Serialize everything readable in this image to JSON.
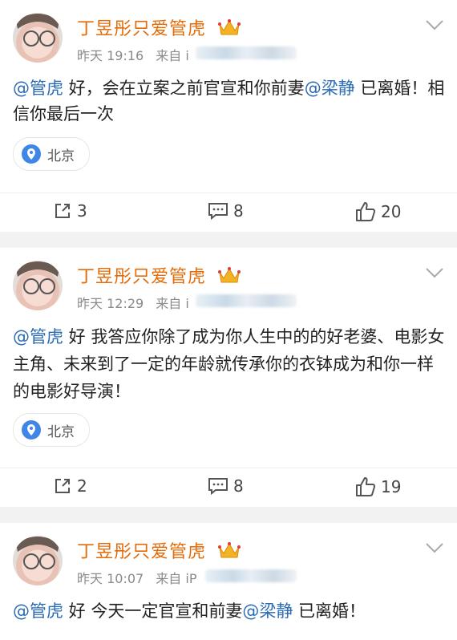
{
  "posts": [
    {
      "author": "丁昱彤只爱管虎",
      "time": "昨天 19:16",
      "source_prefix": "来自 i",
      "text_parts": [
        "@管虎",
        " 好，会在立案之前官宣和你前妻",
        "@梁静",
        " 已离婚！相信你最后一次"
      ],
      "location": "北京",
      "reposts": "3",
      "comments": "8",
      "likes": "20"
    },
    {
      "author": "丁昱彤只爱管虎",
      "time": "昨天 12:29",
      "source_prefix": "来自 i",
      "text_parts": [
        "@管虎",
        " 好 我答应你除了成为你人生中的的好老婆、电影女主角、未来到了一定的年龄就传承你的衣钵成为和你一样的电影好导演！"
      ],
      "location": "北京",
      "reposts": "2",
      "comments": "8",
      "likes": "19"
    },
    {
      "author": "丁昱彤只爱管虎",
      "time": "昨天 10:07",
      "source_prefix": "来自 iP",
      "text_parts": [
        "@管虎",
        " 好 今天一定官宣和前妻",
        "@梁静",
        " 已离婚！"
      ]
    }
  ],
  "icons": {
    "avatar": "avatar-photo",
    "crown": "crown-icon",
    "chevron": "chevron-down-icon",
    "location": "location-pin-icon",
    "repost": "repost-icon",
    "comment": "comment-icon",
    "like": "like-icon"
  },
  "colors": {
    "author": "#e46b08",
    "mention": "#2a6bb5",
    "location_pin": "#3f86e6"
  }
}
